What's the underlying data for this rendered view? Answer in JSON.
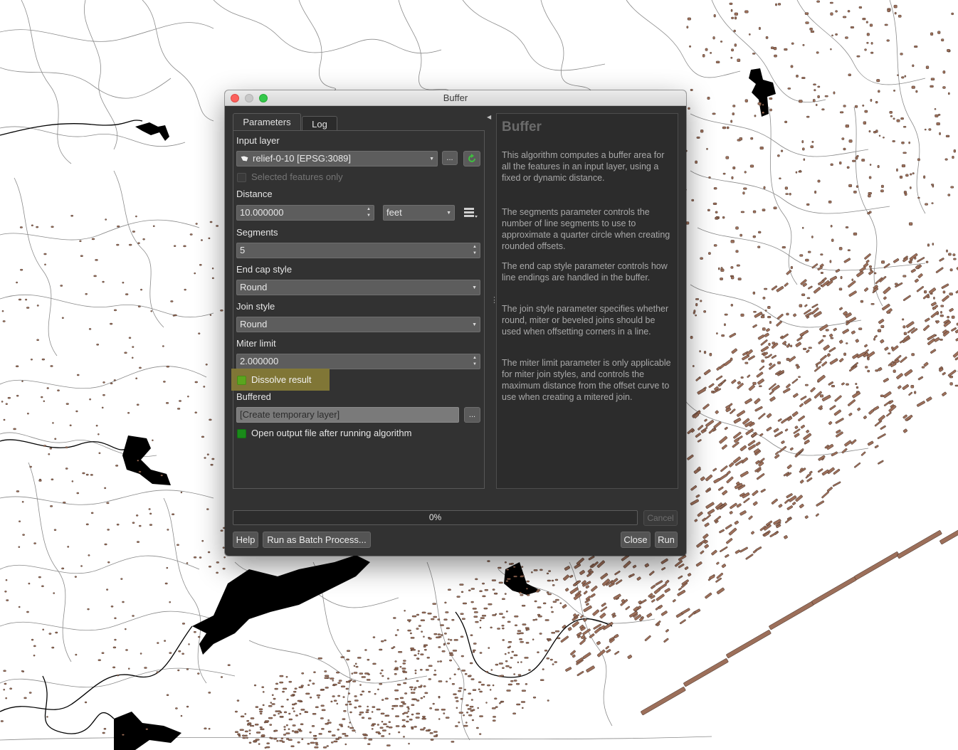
{
  "window": {
    "title": "Buffer"
  },
  "tabs": [
    {
      "label": "Parameters"
    },
    {
      "label": "Log"
    }
  ],
  "params": {
    "input_layer": {
      "label": "Input layer",
      "value": "relief-0-10 [EPSG:3089]"
    },
    "selected_only": {
      "label": "Selected features only",
      "checked": false
    },
    "distance": {
      "label": "Distance",
      "value": "10.000000",
      "unit": "feet"
    },
    "segments": {
      "label": "Segments",
      "value": "5"
    },
    "end_cap": {
      "label": "End cap style",
      "value": "Round"
    },
    "join_style": {
      "label": "Join style",
      "value": "Round"
    },
    "miter_limit": {
      "label": "Miter limit",
      "value": "2.000000"
    },
    "dissolve": {
      "label": "Dissolve result",
      "checked": true
    },
    "buffered": {
      "label": "Buffered",
      "value": "[Create temporary layer]",
      "button_label": "..."
    },
    "open_output": {
      "label": "Open output file after running algorithm",
      "checked": true
    },
    "browse_label": "..."
  },
  "help": {
    "title": "Buffer",
    "paragraphs": [
      "This algorithm computes a buffer area for all the features in an input layer, using a fixed or dynamic distance.",
      "The segments parameter controls the number of line segments to use to approximate a quarter circle when creating rounded offsets.",
      "The end cap style parameter controls how line endings are handled in the buffer.",
      "The join style parameter specifies whether round, miter or beveled joins should be used when offsetting corners in a line.",
      "The miter limit parameter is only applicable for miter join styles, and controls the maximum distance from the offset curve to use when creating a mitered join."
    ]
  },
  "progress": {
    "percent": 0,
    "text": "0%"
  },
  "buttons": {
    "cancel": "Cancel",
    "help": "Help",
    "batch": "Run as Batch Process...",
    "close": "Close",
    "run": "Run"
  },
  "colors": {
    "dialog_bg": "#323232",
    "checkbox_on": "#1a8a1a",
    "highlight": "#857a37",
    "relief_fill": "#9c6f5a",
    "water": "#000000"
  }
}
